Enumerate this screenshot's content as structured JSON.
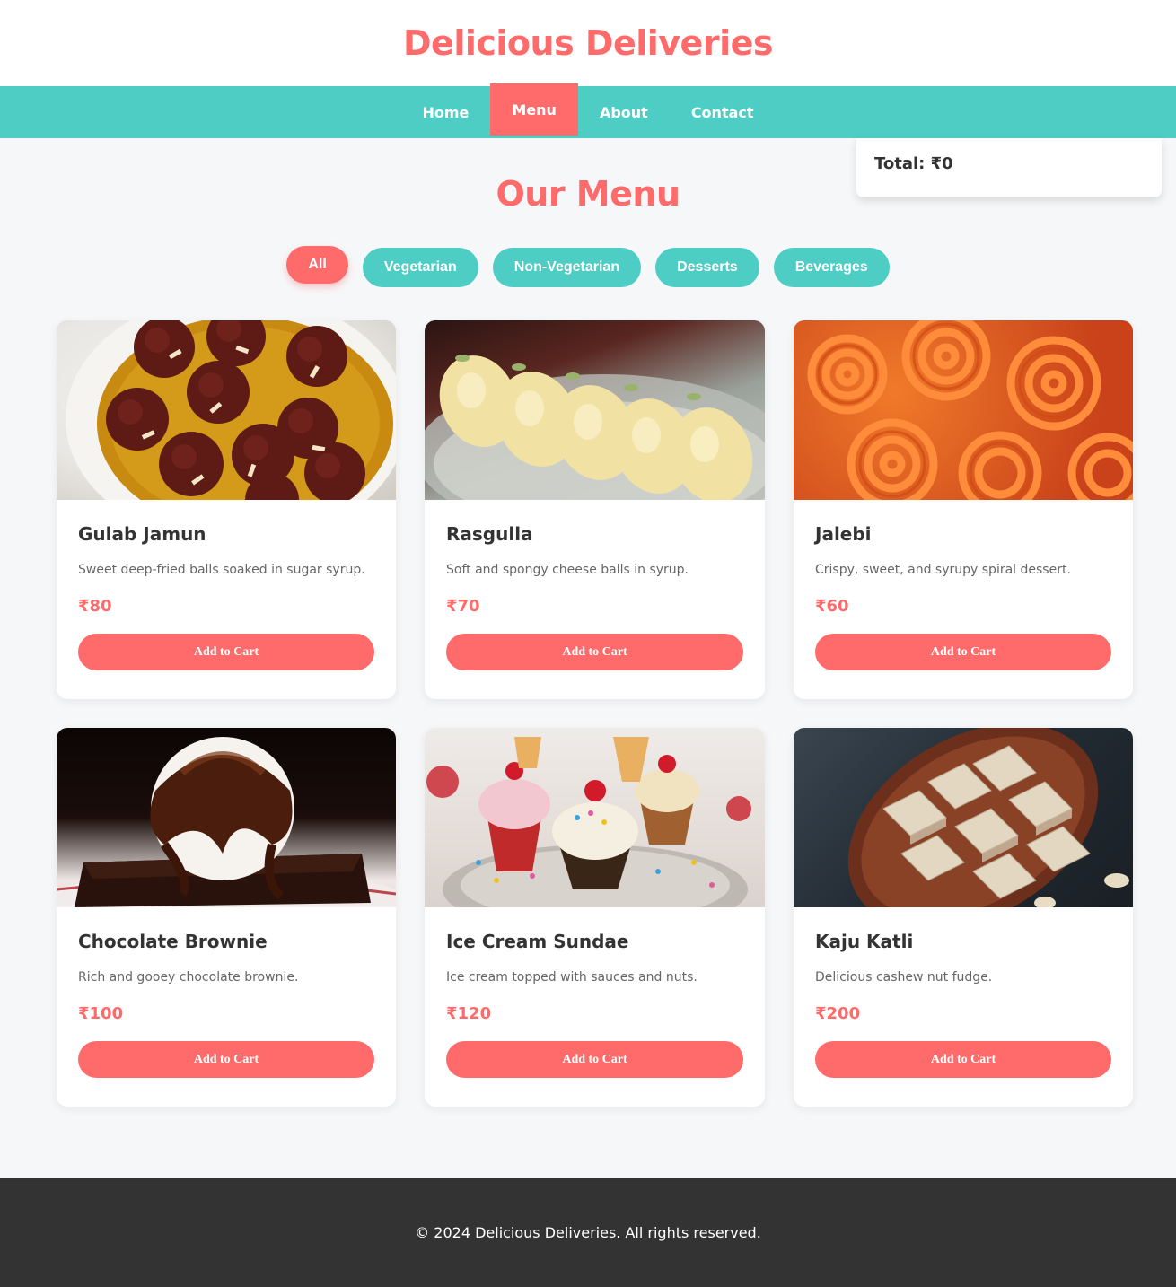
{
  "header": {
    "title": "Delicious Deliveries"
  },
  "nav": {
    "items": [
      {
        "label": "Home",
        "active": false
      },
      {
        "label": "Menu",
        "active": true
      },
      {
        "label": "About",
        "active": false
      },
      {
        "label": "Contact",
        "active": false
      }
    ]
  },
  "cart": {
    "total_label": "Total: ₹0"
  },
  "menu": {
    "title": "Our Menu",
    "filters": [
      {
        "label": "All",
        "active": true
      },
      {
        "label": "Vegetarian",
        "active": false
      },
      {
        "label": "Non-Vegetarian",
        "active": false
      },
      {
        "label": "Desserts",
        "active": false
      },
      {
        "label": "Beverages",
        "active": false
      }
    ],
    "items": [
      {
        "name": "Gulab Jamun",
        "description": "Sweet deep-fried balls soaked in sugar syrup.",
        "price": "₹80",
        "button": "Add to Cart"
      },
      {
        "name": "Rasgulla",
        "description": "Soft and spongy cheese balls in syrup.",
        "price": "₹70",
        "button": "Add to Cart"
      },
      {
        "name": "Jalebi",
        "description": "Crispy, sweet, and syrupy spiral dessert.",
        "price": "₹60",
        "button": "Add to Cart"
      },
      {
        "name": "Chocolate Brownie",
        "description": "Rich and gooey chocolate brownie.",
        "price": "₹100",
        "button": "Add to Cart"
      },
      {
        "name": "Ice Cream Sundae",
        "description": "Ice cream topped with sauces and nuts.",
        "price": "₹120",
        "button": "Add to Cart"
      },
      {
        "name": "Kaju Katli",
        "description": "Delicious cashew nut fudge.",
        "price": "₹200",
        "button": "Add to Cart"
      }
    ]
  },
  "footer": {
    "text": "© 2024 Delicious Deliveries. All rights reserved."
  },
  "colors": {
    "primary": "#ff6b6b",
    "secondary": "#4ecdc4",
    "footer": "#333333",
    "background": "#f6f7f9"
  }
}
